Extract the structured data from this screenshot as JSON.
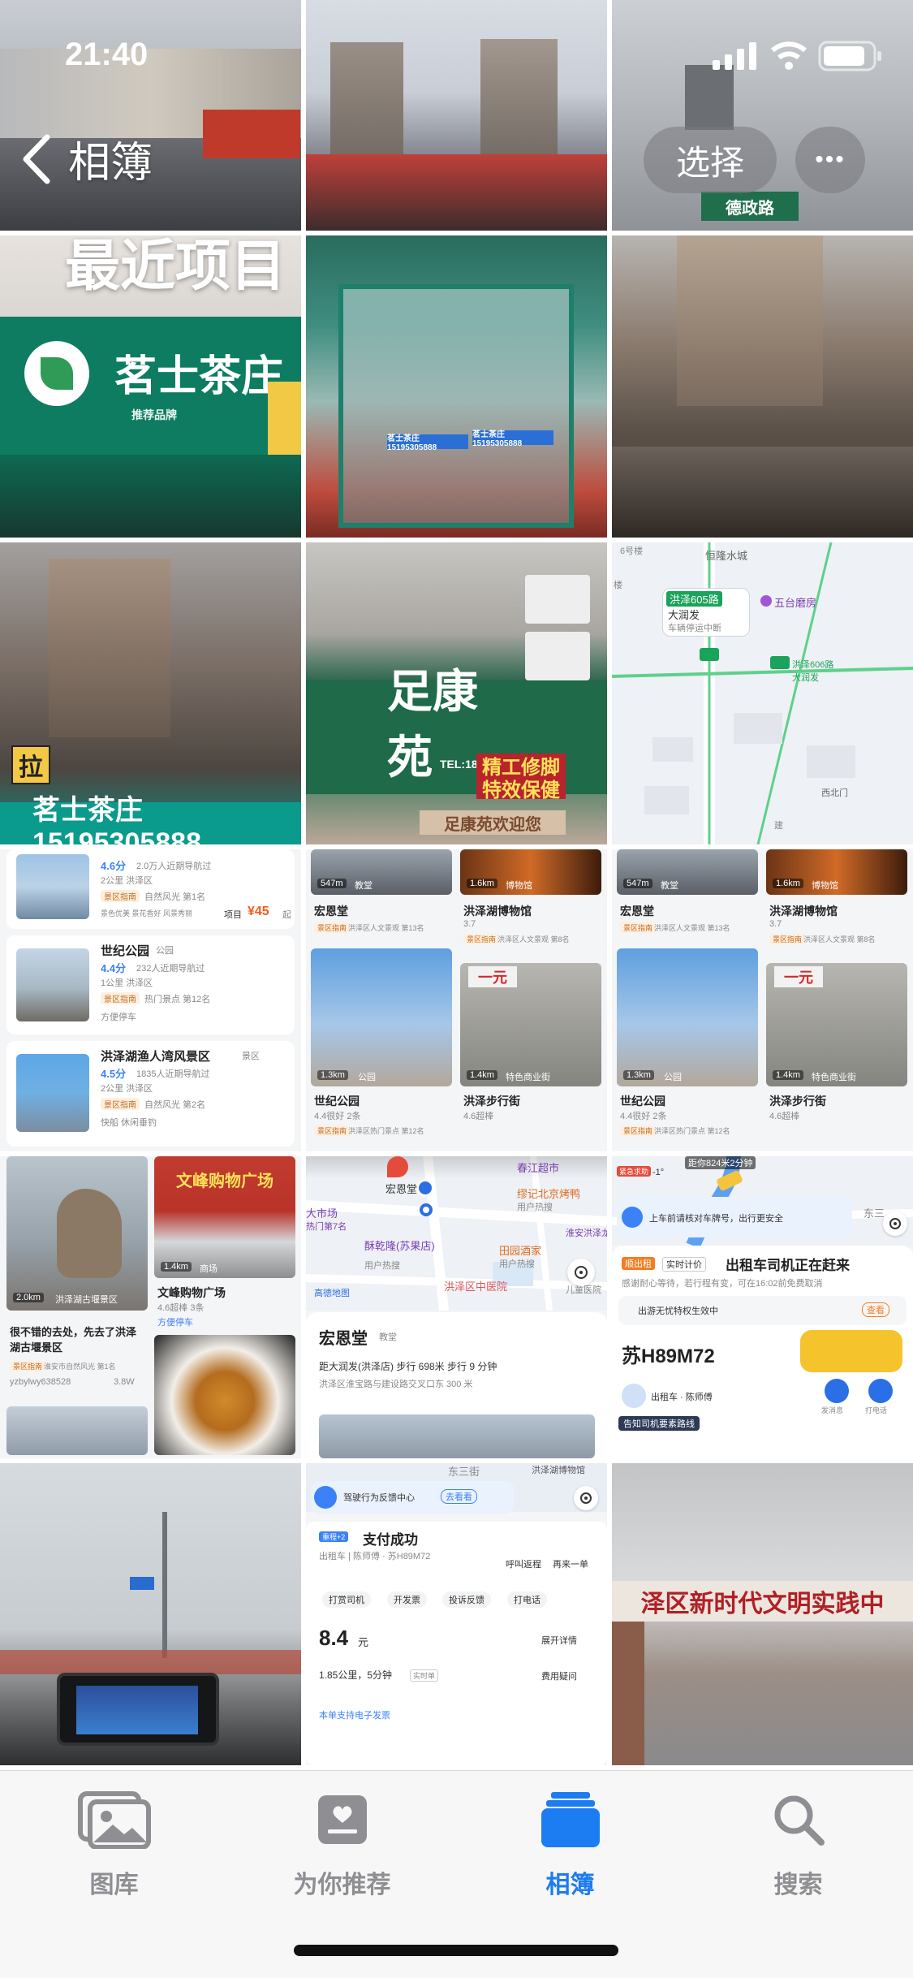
{
  "status": {
    "time": "21:40"
  },
  "nav": {
    "back_label": "相簿",
    "title": "最近项目",
    "select_label": "选择",
    "more_label": "•••"
  },
  "photos": {
    "street_sign": "德政路",
    "tea_shop_name": "茗士茶庄",
    "tea_shop_sub": "推荐品牌",
    "door_label_left": "茗士茶庄 15195305888",
    "door_label_right": "茗士茶庄 15195305888",
    "tea_phone_banner": "茗士茶庄15195305888",
    "pull_sign": "拉",
    "foot_shop_name": "足康苑",
    "foot_shop_tel": "TEL:18013",
    "foot_slogan_1": "精工修脚",
    "foot_slogan_2": "特效保健",
    "foot_welcome": "足康苑欢迎您",
    "gate_text": "泽区新时代文明实践中"
  },
  "map_tile": {
    "area": "恒隆水城",
    "building": "6号楼",
    "floor": "楼",
    "bus_route": "洪泽605路",
    "bus_sub": "大润发",
    "bus_status": "车辆停运中断",
    "poi": "五台磨房",
    "bus_label2": "洪泽606路",
    "bus_label2_sub": "大润发",
    "gate": "西北门",
    "edge": "建"
  },
  "list_left": {
    "item0": {
      "rating": "4.6分",
      "visitors": "2.0万人近期导航过",
      "dist": "2公里 洪泽区",
      "rank_tag": "景区指南",
      "rank": "自然风光 第1名",
      "tags": "景色优美 景花香好 风景秀丽",
      "price_label": "项目",
      "price": "¥45",
      "price_unit": "起"
    },
    "item1": {
      "name": "世纪公园",
      "type": "公园",
      "rating": "4.4分",
      "visitors": "232人近期导航过",
      "dist": "1公里 洪泽区",
      "rank_tag": "景区指南",
      "rank": "热门景点 第12名",
      "tags": "方便停车"
    },
    "item2": {
      "name": "洪泽湖渔人湾风景区",
      "type": "景区",
      "rating": "4.5分",
      "visitors": "1835人近期导航过",
      "dist": "2公里 洪泽区",
      "rank_tag": "景区指南",
      "rank": "自然风光 第2名",
      "tags": "快船 休闲垂钓"
    }
  },
  "grid_mid": {
    "a_dist": "547m",
    "a_type": "教堂",
    "a_name": "宏恩堂",
    "a_rank": "洪泽区人文景观 第13名",
    "b_dist": "1.6km",
    "b_type": "博物馆",
    "b_name": "洪泽湖博物馆",
    "b_score": "3.7",
    "b_rank": "洪泽区人文景观 第8名",
    "c_dist": "1.3km",
    "c_type": "公园",
    "c_name": "世纪公园",
    "c_score": "4.4很好 2条",
    "c_rank": "洪泽区热门景点 第12名",
    "d_banner": "一元",
    "d_dist": "1.4km",
    "d_type": "特色商业街",
    "d_name": "洪泽步行街",
    "d_score": "4.6超棒",
    "guide": "景区指南"
  },
  "row4_left": {
    "rock_dist": "2.0km",
    "rock_place": "洪泽湖古堰景区",
    "rock_caption": "很不错的去处，先去了洪泽湖古堰景区",
    "rock_rank": "淮安市自然风光 第1名",
    "user": "yzbylwy638528",
    "views": "3.8W",
    "mall_sign": "文峰购物广场",
    "mall_dist": "1.4km",
    "mall_type": "商场",
    "mall_name": "文峰购物广场",
    "mall_score": "4.6超棒 3条",
    "mall_tag": "方便停车"
  },
  "row4_map": {
    "top_poi": "春江超市",
    "poi1": "宏恩堂",
    "poi2": "缪记北京烤鸭",
    "poi2_sub": "用户热搜",
    "poi3": "大市场",
    "poi3_sub": "热门第7名",
    "poi4": "酥乾隆(苏果店)",
    "poi4_sub": "用户热搜",
    "poi5": "田园酒家",
    "poi5_sub": "用户热搜",
    "poi6": "淮安洪泽龙虾",
    "poi7": "洪泽区中医院",
    "poi8": "儿童医院",
    "brand": "高德地图",
    "place_name": "宏恩堂",
    "place_type": "教堂",
    "route": "距大润发(洪泽店) 步行 698米 步行 9 分钟",
    "address": "洪泽区淮宝路与建设路交叉口东 300 米"
  },
  "row4_taxi": {
    "eta_hint": "距你824米2分钟",
    "emergency": "紧急求助",
    "temp": "-1°",
    "safety_tip": "上车前请核对车牌号，出行更安全",
    "street": "东三",
    "car_type": "顺出租",
    "price_tag": "实时计价",
    "title": "出租车司机正在赶来",
    "sub": "感谢耐心等待，若行程有变，可在16:02前免费取消",
    "privacy": "出游无忧特权生效中",
    "view": "查看",
    "plate": "苏H89M72",
    "driver": "出租车 · 陈师傅",
    "chat": "发消息",
    "call": "打电话",
    "notify": "告知司机要素路线"
  },
  "row5_pay": {
    "street": "东三街",
    "museum": "洪泽湖博物馆",
    "feedback": "驾驶行为反馈中心",
    "view": "去看看",
    "service": "重程+2",
    "title": "支付成功",
    "sub": "出租车 | 陈师傅 · 苏H89M72",
    "action1": "呼叫返程",
    "action2": "再来一单",
    "btn1": "打赏司机",
    "btn2": "开发票",
    "btn3": "投诉反馈",
    "btn4": "打电话",
    "price": "8.4",
    "price_unit": "元",
    "detail": "展开详情",
    "trip": "1.85公里，5分钟",
    "trip_tag": "实时单",
    "fee_q": "费用疑问",
    "invoice": "本单支持电子发票"
  },
  "tabs": [
    {
      "label": "图库",
      "icon": "photo-library-icon"
    },
    {
      "label": "为你推荐",
      "icon": "for-you-icon"
    },
    {
      "label": "相簿",
      "icon": "albums-icon"
    },
    {
      "label": "搜索",
      "icon": "search-icon"
    }
  ],
  "colors": {
    "accent": "#1c7cf2",
    "inactive": "#8e8e93",
    "brand_green": "#0b7a5f",
    "orange": "#f57c1f"
  }
}
